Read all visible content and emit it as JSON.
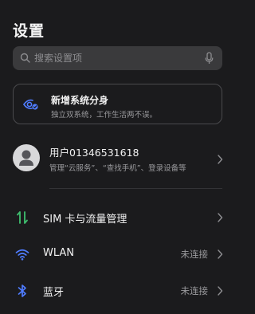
{
  "header": {
    "title": "设置"
  },
  "search": {
    "placeholder": "搜索设置项"
  },
  "banner": {
    "title": "新增系统分身",
    "subtitle": "独立双系统，工作生活两不误。"
  },
  "account": {
    "name": "用户01346531618",
    "subtitle": "管理“云服务”、“查找手机”、登录设备等"
  },
  "items": [
    {
      "label": "SIM 卡与流量管理",
      "value": "",
      "icon": "sim-icon",
      "color": "#3fbf6f"
    },
    {
      "label": "WLAN",
      "value": "未连接",
      "icon": "wifi-icon",
      "color": "#4f7cff"
    },
    {
      "label": "蓝牙",
      "value": "未连接",
      "icon": "bluetooth-icon",
      "color": "#4f7cff"
    }
  ],
  "colors": {
    "background": "#1b1b1d",
    "search_bg": "#3a3a3c",
    "banner_icon": "#4f7cff",
    "secondary_text": "#9b9b9e"
  }
}
